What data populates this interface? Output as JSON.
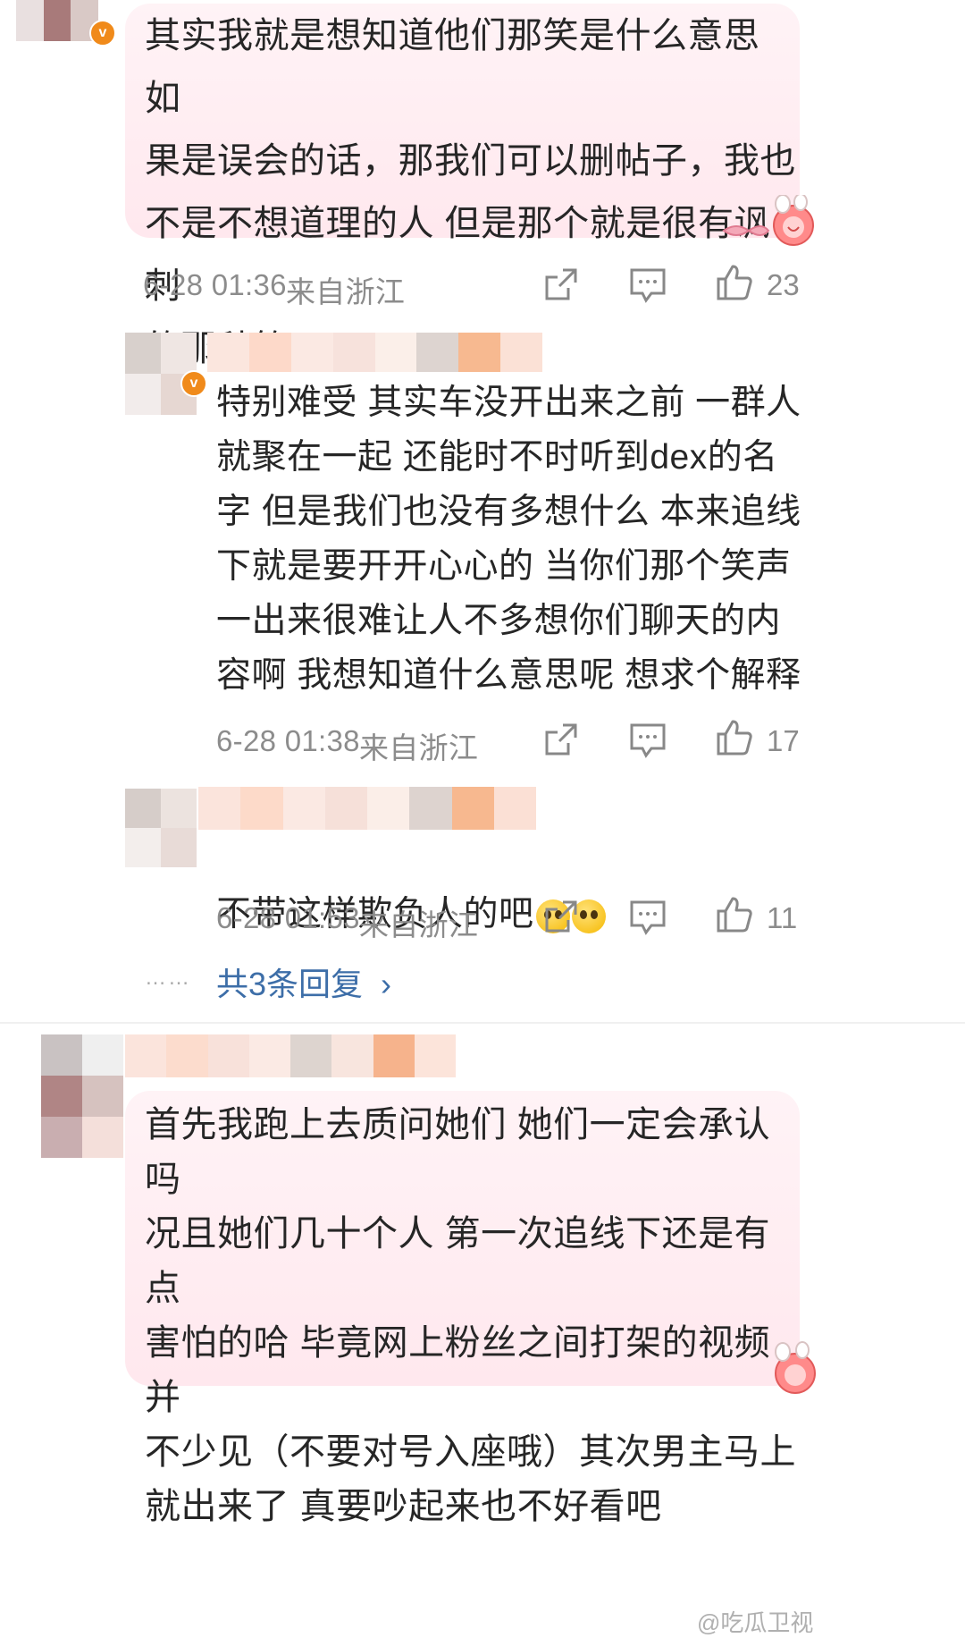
{
  "comments": [
    {
      "text": "其实我就是想知道他们那笑是什么意思 如\n果是误会的话，那我们可以删帖子，我也\n不是不想道理的人 但是那个就是很有讽刺\n的那种笑",
      "time": "6-28 01:36",
      "location": "来自浙江",
      "likes": "23"
    },
    {
      "text": "特别难受 其实车没开出来之前 一群人\n就聚在一起 还能时不时听到dex的名\n字  但是我们也没有多想什么 本来追线\n下就是要开开心心的 当你们那个笑声\n一出来很难让人不多想你们聊天的内\n容啊 我想知道什么意思呢 想求个解释",
      "time": "6-28 01:38",
      "location": "来自浙江",
      "likes": "17"
    },
    {
      "text": "不带这样欺负人的吧",
      "time": "6-28 01:53",
      "location": "来自浙江",
      "likes": "11"
    },
    {
      "text": "首先我跑上去质问她们 她们一定会承认吗\n况且她们几十个人 第一次追线下还是有点\n害怕的哈 毕竟网上粉丝之间打架的视频并\n不少见（不要对号入座哦）其次男主马上\n就出来了 真要吵起来也不好看吧"
    }
  ],
  "more_replies": "共3条回复",
  "more_dots": "……",
  "reply_arrow": "›",
  "badge_glyph": "v",
  "watermark": "@吃瓜卫视",
  "icons": [
    "share-icon",
    "comment-icon",
    "like-icon",
    "chevron-right-icon",
    "sad-face-emoji"
  ],
  "colors": {
    "bubble": "#ffeef2",
    "meta_text": "#8c8c8c",
    "link": "#3d6ea8",
    "badge": "#f08a1a"
  }
}
